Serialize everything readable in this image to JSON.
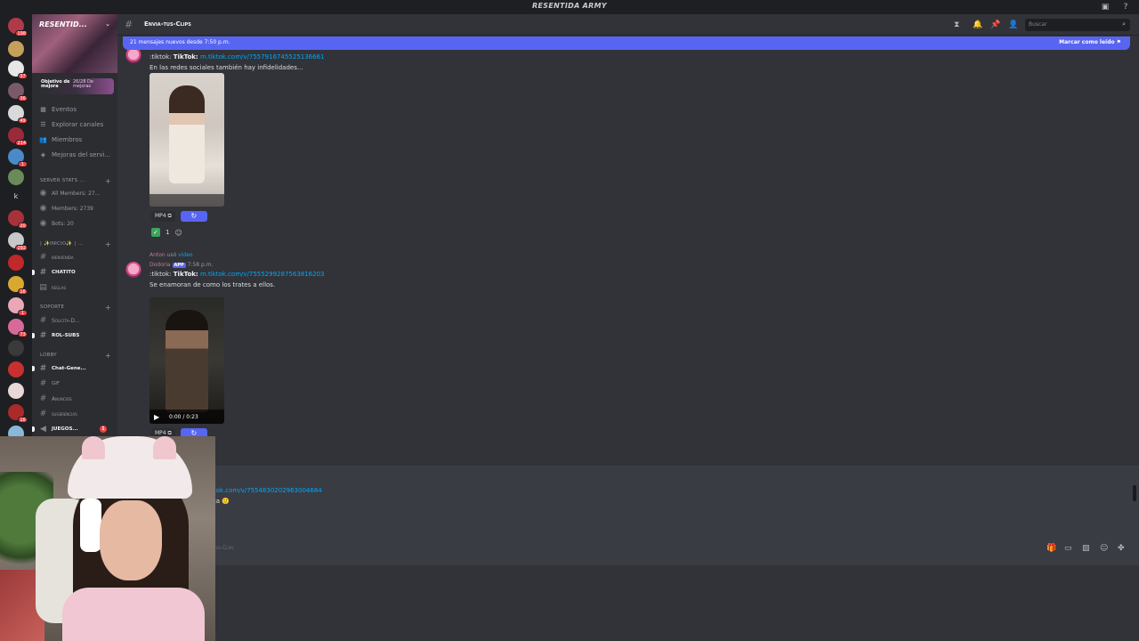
{
  "window": {
    "title": "RESENTIDA ARMY"
  },
  "server": {
    "name": "RESENTID...",
    "boost": {
      "goal_label": "Objetivo de mejora",
      "progress_label": "26/28 De mejoras"
    },
    "nav": [
      {
        "label": "Eventos",
        "icon": "calendar-icon"
      },
      {
        "label": "Explorar canales",
        "icon": "list-icon"
      },
      {
        "label": "Miembros",
        "icon": "members-icon"
      },
      {
        "label": "Mejoras del servi...",
        "icon": "boost-icon"
      }
    ],
    "categories": {
      "server_stats": "SERVER STATS ...",
      "inicio": "| ✨INICIO✨ | ...",
      "soporte": "SOPORTE",
      "lobby": "LOBBY"
    },
    "stats": [
      {
        "label": "All Members: 27..."
      },
      {
        "label": "Members: 2739"
      },
      {
        "label": "Bots: 20"
      }
    ],
    "channels": {
      "bienvenida": "bienvenida",
      "chatito": "CHATITO",
      "reglas": "reglas",
      "solicita": "Solicita-D...",
      "rol_subs": "ROL-SUBS",
      "chat_general": "Chat-Gene...",
      "gif": "GIF",
      "anuncios": "Anuncios",
      "sugerencias": "sugerencias",
      "juegos": "JUEGOS...",
      "juegos_badge": "1"
    },
    "server_list_badges": [
      "198",
      "37",
      "36",
      "49",
      "214",
      "1",
      "20",
      "292",
      "16",
      "1",
      "73",
      "16"
    ]
  },
  "channel_header": {
    "name": "Envia-tus-Clips",
    "search_placeholder": "Buscar"
  },
  "new_messages_bar": {
    "text": "21 mensajes nuevos desde 7:50 p.m.",
    "mark_read": "Marcar como leído"
  },
  "messages": [
    {
      "prefix": ":tiktok:",
      "platform": "TikTok:",
      "link": "m.tiktok.com/v/7557916745525136661",
      "text": "En las redes sociales también hay infidelidades...",
      "attachment_format": "MP4",
      "reaction_count": "1"
    },
    {
      "reply_user": "Anton",
      "reply_used": "usó",
      "reply_command": "video",
      "author": "Dodoria",
      "author_tag": "APP",
      "timestamp": "7:58 p.m.",
      "prefix": ":tiktok:",
      "platform": "TikTok:",
      "link": "m.tiktok.com/v/7555299287563816203",
      "text": "Se enamoran de como los trates a ellos.",
      "video_time": "0:00 / 0:23",
      "attachment_format": "MP4"
    }
  ],
  "composer": {
    "partial_link": "tok.com/v/7554830202963004684",
    "partial_text": "ta",
    "placeholder": "tus-Clips"
  },
  "colors": {
    "accent": "#5865f2",
    "link": "#00a8fc",
    "badge": "#f23f43",
    "bg_chat": "#313338",
    "bg_sidebar": "#2b2d31",
    "bg_servers": "#1e1f22"
  }
}
